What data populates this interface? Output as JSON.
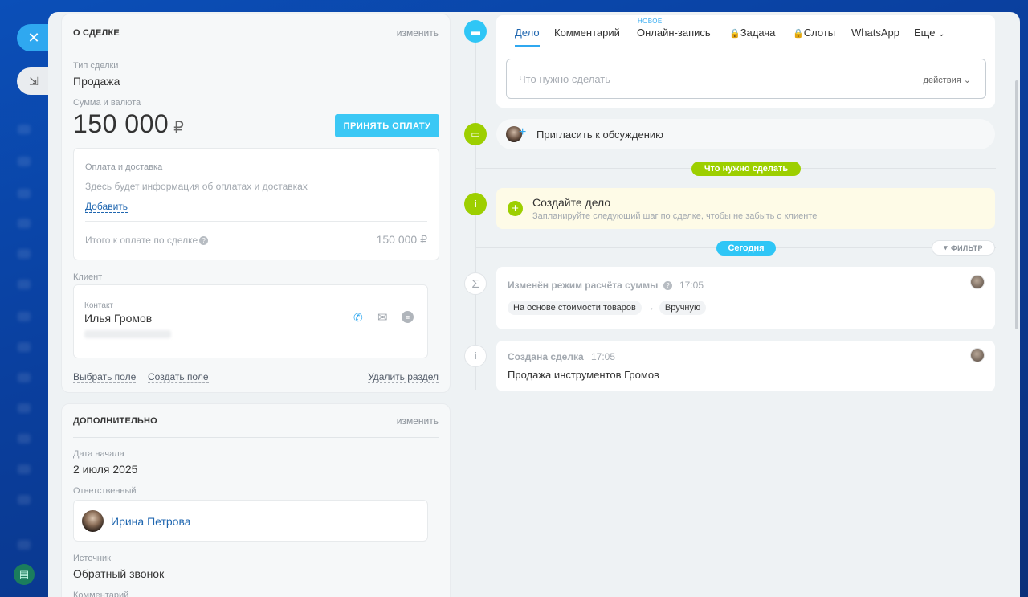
{
  "window": {
    "close_icon": "close-icon",
    "collapse_icon": "collapse-icon",
    "print_icon": "print-icon"
  },
  "deal_card": {
    "title": "О СДЕЛКЕ",
    "change": "изменить",
    "type_label": "Тип сделки",
    "type_value": "Продажа",
    "amount_label": "Сумма и валюта",
    "amount_value": "150 000",
    "currency": "₽",
    "accept_payment": "ПРИНЯТЬ ОПЛАТУ",
    "payment_block": {
      "title": "Оплата и доставка",
      "info": "Здесь будет информация об оплатах и доставках",
      "add_link": "Добавить",
      "total_label": "Итого к оплате по сделке",
      "total_value": "150 000 ₽"
    },
    "client_label": "Клиент",
    "contact_label": "Контакт",
    "contact_name": "Илья Громов",
    "select_field": "Выбрать поле",
    "create_field": "Создать поле",
    "delete_section": "Удалить раздел"
  },
  "extra_card": {
    "title": "ДОПОЛНИТЕЛЬНО",
    "change": "изменить",
    "start_label": "Дата начала",
    "start_value": "2 июля 2025",
    "responsible_label": "Ответственный",
    "responsible_name": "Ирина Петрова",
    "source_label": "Источник",
    "source_value": "Обратный звонок",
    "comment_label": "Комментарий"
  },
  "timeline": {
    "tabs": [
      "Дело",
      "Комментарий",
      "Онлайн-запись",
      "Задача",
      "Слоты",
      "WhatsApp",
      "Еще"
    ],
    "new_badge": "НОВОЕ",
    "todo_placeholder": "Что нужно сделать",
    "actions": "действия",
    "invite": "Пригласить к обсуждению",
    "todo_pill": "Что нужно сделать",
    "create_task_title": "Создайте дело",
    "create_task_hint": "Запланируйте следующий шаг по сделке, чтобы не забыть о клиенте",
    "today_pill": "Сегодня",
    "filter": "ФИЛЬТР",
    "event1": {
      "title": "Изменён режим расчёта суммы",
      "time": "17:05",
      "from": "На основе стоимости товаров",
      "to": "Вручную"
    },
    "event2": {
      "title": "Создана сделка",
      "time": "17:05",
      "body": "Продажа инструментов Громов"
    }
  },
  "colors": {
    "accent": "#3bc8f5",
    "green": "#9dcf00",
    "link": "#2067b0"
  }
}
